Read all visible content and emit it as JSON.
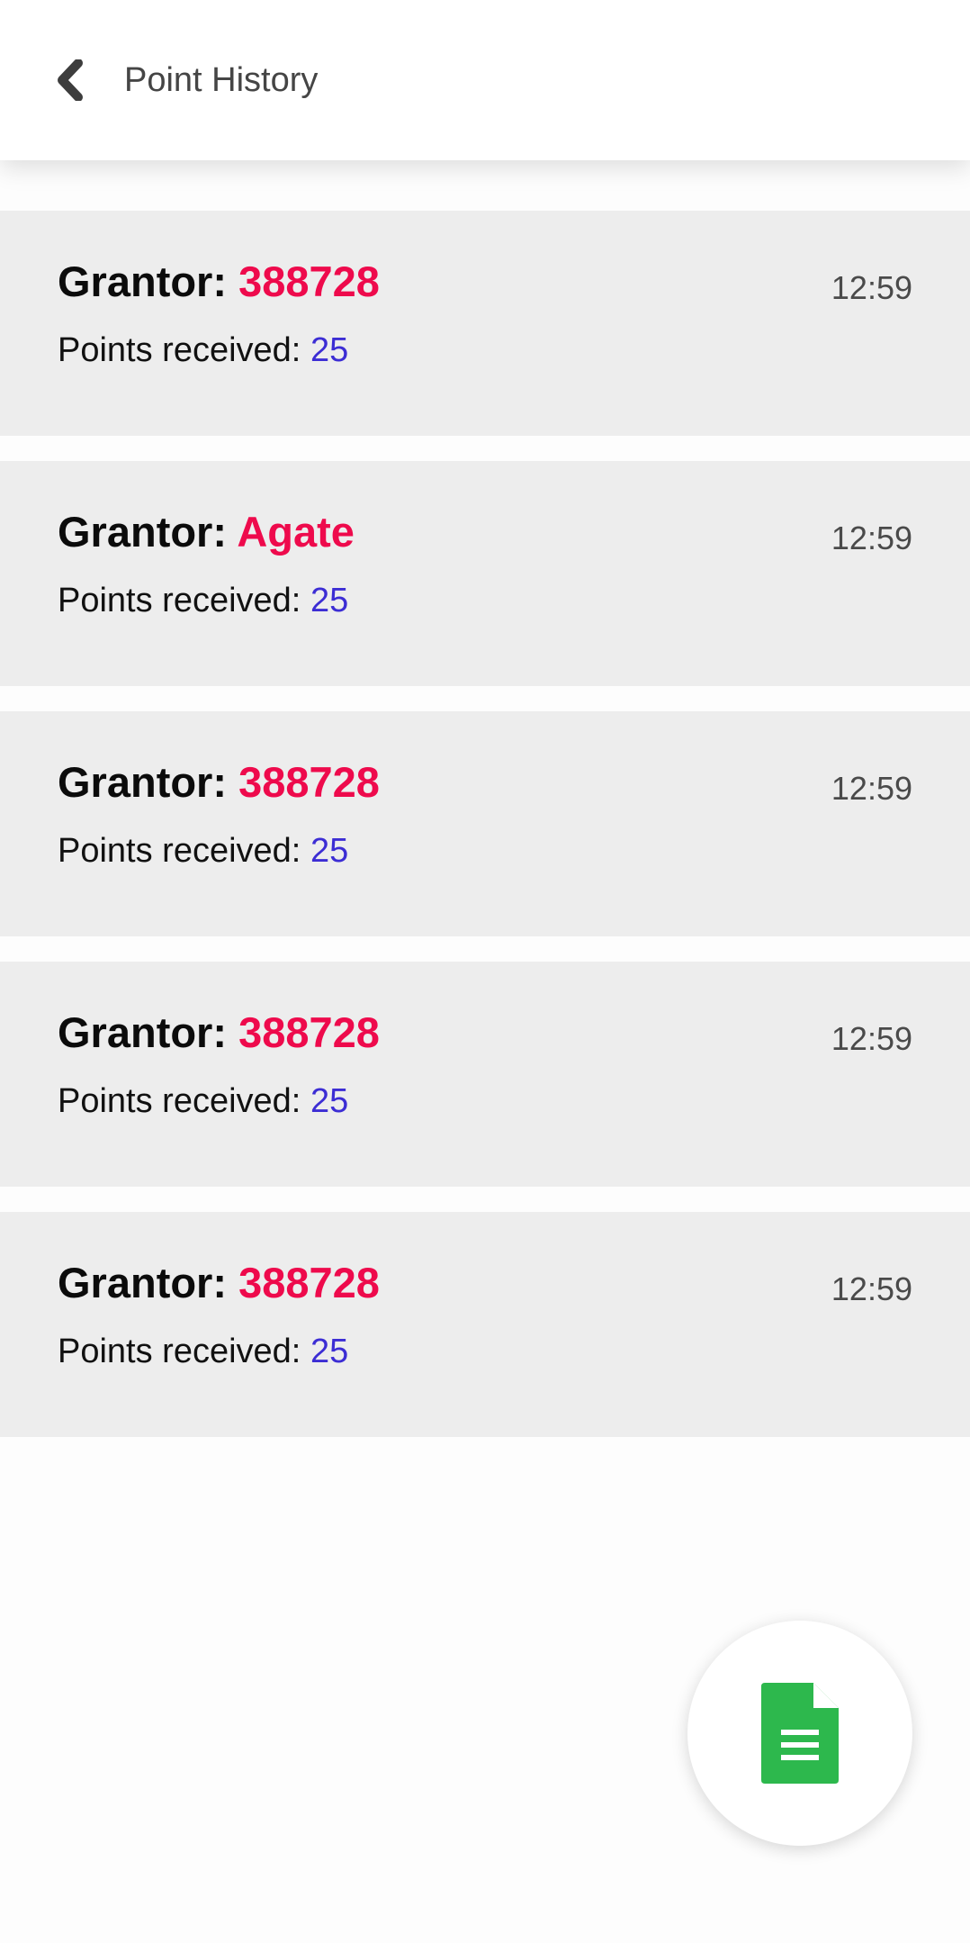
{
  "header": {
    "title": "Point History",
    "back_icon": "chevron-left-icon"
  },
  "history": {
    "items": [
      {
        "grantor_label": "Grantor:",
        "grantor": "388728",
        "points_label": "Points received:",
        "points": "25",
        "time": "12:59"
      },
      {
        "grantor_label": "Grantor:",
        "grantor": "Agate",
        "points_label": "Points received:",
        "points": "25",
        "time": "12:59"
      },
      {
        "grantor_label": "Grantor:",
        "grantor": "388728",
        "points_label": "Points received:",
        "points": "25",
        "time": "12:59"
      },
      {
        "grantor_label": "Grantor:",
        "grantor": "388728",
        "points_label": "Points received:",
        "points": "25",
        "time": "12:59"
      },
      {
        "grantor_label": "Grantor:",
        "grantor": "388728",
        "points_label": "Points received:",
        "points": "25",
        "time": "12:59"
      }
    ]
  },
  "fab": {
    "icon": "document-icon",
    "icon_color": "#2db84d"
  },
  "colors": {
    "grantor": "#ee0a4c",
    "points": "#3c2dd4",
    "card_bg": "#ededed"
  }
}
